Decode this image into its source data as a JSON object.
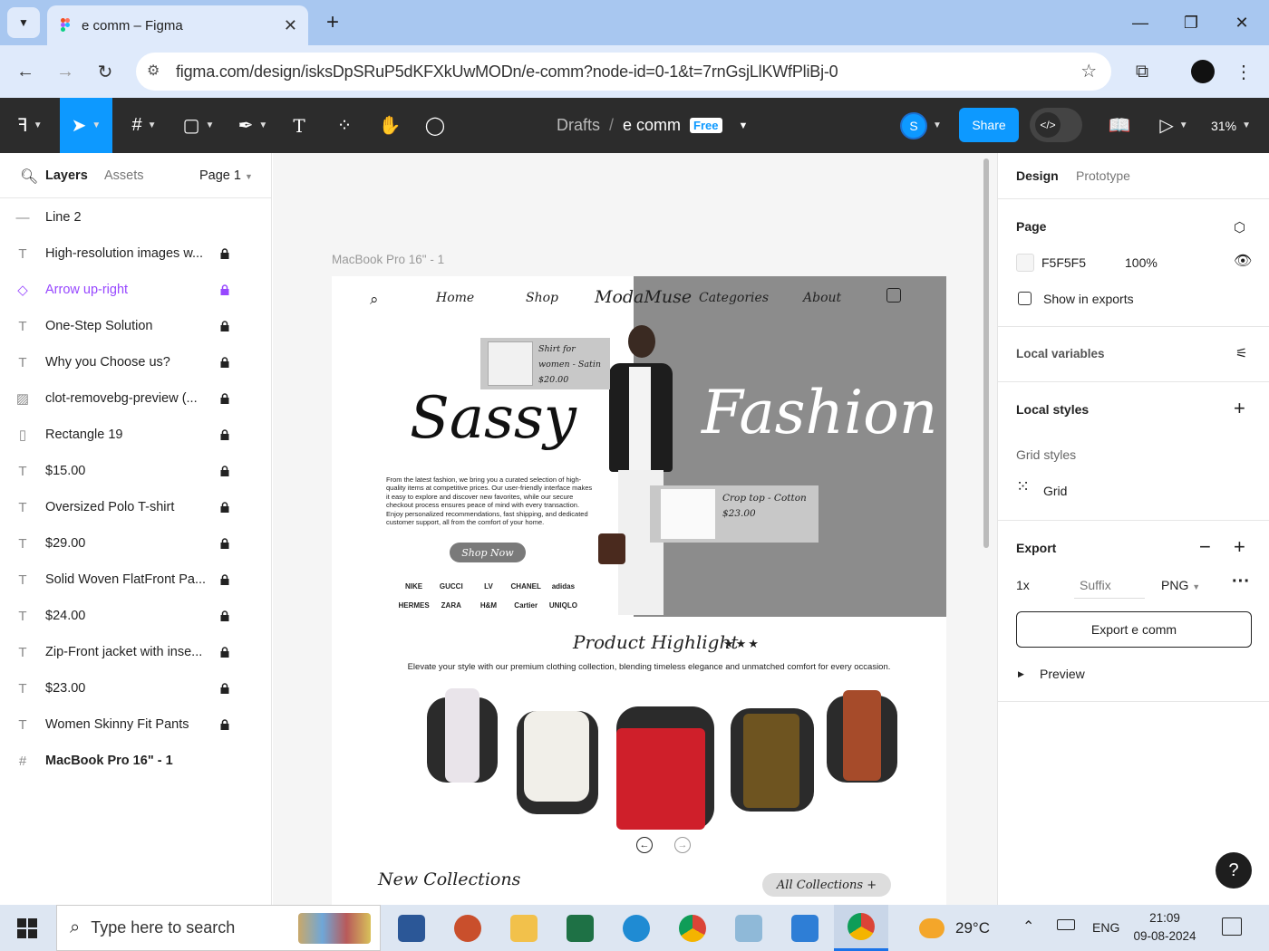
{
  "browser": {
    "tab_title": "e comm – Figma",
    "new_tab": "+",
    "url": "figma.com/design/isksDpSRuP5dKFXkUwMODn/e-comm?node-id=0-1&t=7rnGsjLlKWfPliBj-0",
    "profile_initial": ""
  },
  "toolbar": {
    "breadcrumb_root": "Drafts",
    "breadcrumb_sep": "/",
    "file_name": "e comm",
    "plan_badge": "Free",
    "user_initial": "S",
    "share_label": "Share",
    "zoom": "31%"
  },
  "left_panel": {
    "tab_layers": "Layers",
    "tab_assets": "Assets",
    "page_selector": "Page 1",
    "layers": [
      {
        "name": "Line 2",
        "icon": "line-icon",
        "locked": false
      },
      {
        "name": "High-resolution images w...",
        "icon": "text-icon",
        "locked": true
      },
      {
        "name": "Arrow up-right",
        "icon": "component-icon",
        "locked": true,
        "purple": true
      },
      {
        "name": "One-Step Solution",
        "icon": "text-icon",
        "locked": true
      },
      {
        "name": "Why you Choose us?",
        "icon": "text-icon",
        "locked": true
      },
      {
        "name": "clot-removebg-preview (...",
        "icon": "image-icon",
        "locked": true
      },
      {
        "name": "Rectangle 19",
        "icon": "rectangle-icon",
        "locked": true
      },
      {
        "name": "$15.00",
        "icon": "text-icon",
        "locked": true
      },
      {
        "name": "Oversized Polo T-shirt",
        "icon": "text-icon",
        "locked": true
      },
      {
        "name": "$29.00",
        "icon": "text-icon",
        "locked": true
      },
      {
        "name": "Solid Woven FlatFront Pa...",
        "icon": "text-icon",
        "locked": true
      },
      {
        "name": "$24.00",
        "icon": "text-icon",
        "locked": true
      },
      {
        "name": "Zip-Front jacket with inse...",
        "icon": "text-icon",
        "locked": true
      },
      {
        "name": "$23.00",
        "icon": "text-icon",
        "locked": true
      },
      {
        "name": "Women Skinny Fit Pants",
        "icon": "text-icon",
        "locked": true
      },
      {
        "name": "MacBook Pro 16\" - 1",
        "icon": "frame-icon",
        "locked": false,
        "bold": true
      }
    ]
  },
  "right_panel": {
    "tab_design": "Design",
    "tab_prototype": "Prototype",
    "page_heading": "Page",
    "page_color": "F5F5F5",
    "page_opacity": "100%",
    "show_in_exports": "Show in exports",
    "local_variables": "Local variables",
    "local_styles": "Local styles",
    "grid_styles": "Grid styles",
    "grid": "Grid",
    "export_heading": "Export",
    "export_scale": "1x",
    "export_suffix_placeholder": "Suffix",
    "export_format": "PNG",
    "export_button": "Export e comm",
    "preview": "Preview",
    "help": "?"
  },
  "canvas": {
    "frame_label": "MacBook Pro 16\" - 1",
    "design": {
      "nav": [
        "Home",
        "Shop",
        "Categories",
        "About"
      ],
      "logo": "ModaMuse",
      "hero_left": "Sassy",
      "hero_right": "Fashion",
      "card1": "Shirt for women - Satin $20.00",
      "card2": "Crop top - Cotton $23.00",
      "hero_copy": "From the latest fashion, we bring you a curated selection of high-quality items at competitive prices. Our user-friendly interface makes it easy to explore and discover new favorites, while our secure checkout process ensures peace of mind with every transaction. Enjoy personalized recommendations, fast shipping, and dedicated customer support, all from the comfort of your home.",
      "shop_now": "Shop Now",
      "brands": [
        "NIKE",
        "GUCCI",
        "LV",
        "CHANEL",
        "adidas",
        "HERMES",
        "ZARA",
        "H&M",
        "Cartier",
        "UNIQLO"
      ],
      "highlight_title": "Product Highlight",
      "stars": "★★★",
      "highlight_copy": "Elevate your style with our premium clothing collection, blending timeless elegance and unmatched comfort for every occasion.",
      "new_collections": "New Collections",
      "all_collections": "All Collections +"
    }
  },
  "taskbar": {
    "search_placeholder": "Type here to search",
    "weather": "29°C",
    "lang": "ENG",
    "time": "21:09",
    "date": "09-08-2024"
  },
  "colors": {
    "figma_dark": "#2c2c2c",
    "figma_blue": "#0d99ff",
    "chrome_tab_strip": "#a8c7f0",
    "hero_grey": "#8c8c8c"
  }
}
